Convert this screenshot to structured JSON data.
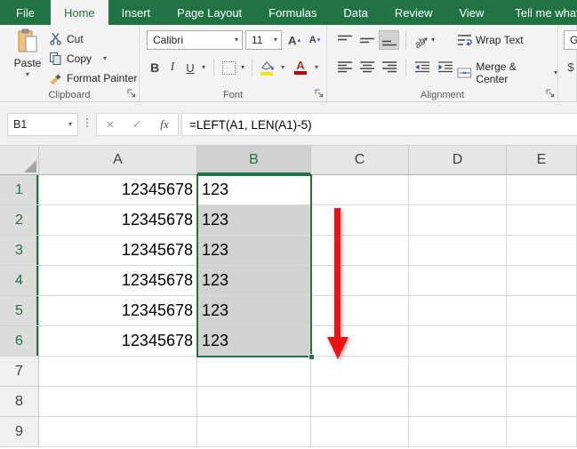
{
  "colors": {
    "brand_green": "#217346",
    "arrow_red": "#ee1212",
    "fill_yellow": "#ffe100",
    "font_color_red": "#c00000",
    "selection_gray": "#d2d2d2"
  },
  "tabs": {
    "items": [
      "File",
      "Home",
      "Insert",
      "Page Layout",
      "Formulas",
      "Data",
      "Review",
      "View"
    ],
    "active": "Home",
    "tell_me": "Tell me what you"
  },
  "icons": {
    "dropdown_caret": "▾",
    "up_caret": "▴",
    "cancel": "×",
    "enter": "✓"
  },
  "ribbon": {
    "clipboard": {
      "title": "Clipboard",
      "paste": "Paste",
      "cut": "Cut",
      "copy": "Copy",
      "format_painter": "Format Painter"
    },
    "font": {
      "title": "Font",
      "font_name": "Calibri",
      "font_size": "11",
      "bold": "B",
      "italic": "I",
      "underline": "U",
      "grow_letter": "A",
      "shrink_letter": "A",
      "font_color_letter": "A"
    },
    "alignment": {
      "title": "Alignment",
      "wrap_text": "Wrap Text",
      "merge_center": "Merge & Center"
    },
    "number": {
      "format_partial": "Ge",
      "currency": "$"
    }
  },
  "formula_bar": {
    "name_box": "B1",
    "fx": "fx",
    "formula": "=LEFT(A1, LEN(A1)-5)"
  },
  "grid": {
    "columns": [
      "A",
      "B",
      "C",
      "D",
      "E"
    ],
    "selected_range": "B1:B6",
    "rows": [
      {
        "n": "1",
        "A": "12345678",
        "B": "123"
      },
      {
        "n": "2",
        "A": "12345678",
        "B": "123"
      },
      {
        "n": "3",
        "A": "12345678",
        "B": "123"
      },
      {
        "n": "4",
        "A": "12345678",
        "B": "123"
      },
      {
        "n": "5",
        "A": "12345678",
        "B": "123"
      },
      {
        "n": "6",
        "A": "12345678",
        "B": "123"
      },
      {
        "n": "7",
        "A": "",
        "B": ""
      },
      {
        "n": "8",
        "A": "",
        "B": ""
      },
      {
        "n": "9",
        "A": "",
        "B": ""
      }
    ]
  }
}
